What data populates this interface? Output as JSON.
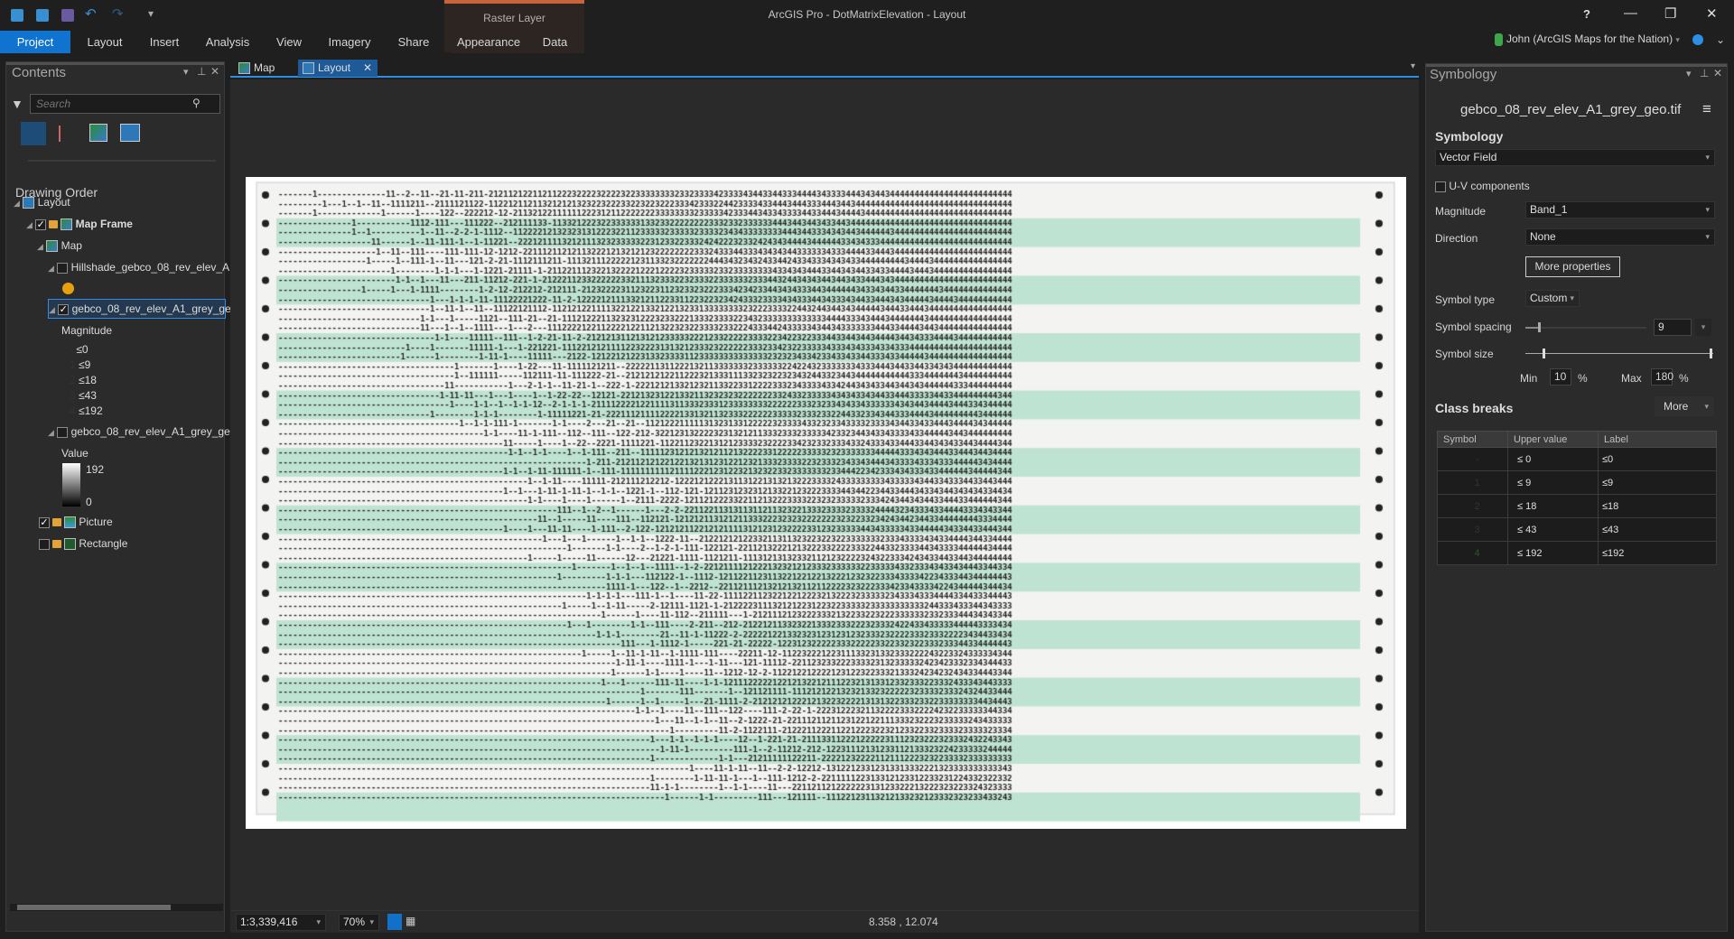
{
  "app": {
    "title": "ArcGIS Pro - DotMatrixElevation - Layout",
    "context_tab": "Raster Layer",
    "help": "?",
    "user": "John (ArcGIS Maps for the Nation)"
  },
  "ribbon": {
    "tabs": [
      {
        "label": "Project",
        "active": true
      },
      {
        "label": "Layout"
      },
      {
        "label": "Insert"
      },
      {
        "label": "Analysis"
      },
      {
        "label": "View"
      },
      {
        "label": "Imagery"
      },
      {
        "label": "Share"
      },
      {
        "label": "Appearance"
      },
      {
        "label": "Data"
      }
    ]
  },
  "contents": {
    "title": "Contents",
    "search_placeholder": "Search",
    "drawing_order": "Drawing Order",
    "items": {
      "layout": "Layout",
      "map_frame": "Map Frame",
      "map": "Map",
      "hillshade": "Hillshade_gebco_08_rev_elev_A",
      "gebco_vector": "gebco_08_rev_elev_A1_grey_ge",
      "magnitude": "Magnitude",
      "gebco_grey": "gebco_08_rev_elev_A1_grey_ge",
      "value": "Value",
      "value_max": "192",
      "value_min": "0",
      "picture": "Picture",
      "rectangle": "Rectangle"
    },
    "magnitude_classes": [
      "≤0",
      "≤9",
      "≤18",
      "≤43",
      "≤192"
    ],
    "hillshade_color": "#e8a010"
  },
  "doc_tabs": [
    {
      "label": "Map"
    },
    {
      "label": "Layout",
      "active": true
    }
  ],
  "status": {
    "scale": "1:3,339,416",
    "zoom": "70%",
    "coords": "8.358 , 12.074"
  },
  "symbology": {
    "title": "Symbology",
    "layer": "gebco_08_rev_elev_A1_grey_geo.tif",
    "heading": "Symbology",
    "renderer": "Vector Field",
    "uv_label": "U-V components",
    "uv_checked": false,
    "magnitude_label": "Magnitude",
    "magnitude_value": "Band_1",
    "direction_label": "Direction",
    "direction_value": "None",
    "more_properties": "More properties",
    "symbol_type_label": "Symbol type",
    "symbol_type_value": "Custom",
    "spacing_label": "Symbol spacing",
    "spacing_value": "9",
    "size_label": "Symbol size",
    "min_label": "Min",
    "min_value": "10",
    "max_label": "Max",
    "max_value": "180",
    "pct": "%",
    "class_breaks": "Class breaks",
    "more": "More",
    "table": {
      "headers": [
        "Symbol",
        "Upper value",
        "Label"
      ],
      "rows": [
        {
          "symbol": "-",
          "upper": "≤  0",
          "label": "≤0"
        },
        {
          "symbol": "1",
          "upper": "≤  9",
          "label": "≤9"
        },
        {
          "symbol": "2",
          "upper": "≤  18",
          "label": "≤18"
        },
        {
          "symbol": "3",
          "upper": "≤  43",
          "label": "≤43"
        },
        {
          "symbol": "4",
          "upper": "≤  192",
          "label": "≤192"
        }
      ]
    }
  },
  "accent": "#0f73cf"
}
